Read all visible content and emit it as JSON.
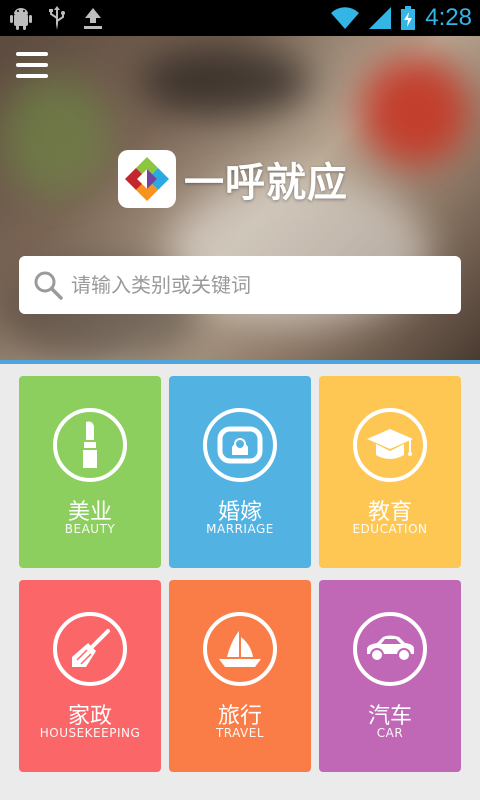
{
  "status_bar": {
    "time": "4:28",
    "left_icons": [
      "android-debug-icon",
      "usb-icon",
      "download-icon"
    ],
    "right_icons": [
      "wifi-icon",
      "signal-icon",
      "battery-charging-icon"
    ]
  },
  "header": {
    "app_name": "一呼就应",
    "menu_icon": "hamburger-menu-icon"
  },
  "search": {
    "placeholder": "请输入类别或关键词"
  },
  "categories": [
    {
      "name": "美业",
      "name_en": "BEAUTY",
      "icon": "lipstick-icon",
      "color": "#8ccf5f"
    },
    {
      "name": "婚嫁",
      "name_en": "MARRIAGE",
      "icon": "ring-box-icon",
      "color": "#52b3e3"
    },
    {
      "name": "教育",
      "name_en": "EDUCATION",
      "icon": "graduation-cap-icon",
      "color": "#fec653"
    },
    {
      "name": "家政",
      "name_en": "HOUSEKEEPING",
      "icon": "broom-icon",
      "color": "#fb6669"
    },
    {
      "name": "旅行",
      "name_en": "TRAVEL",
      "icon": "sailboat-icon",
      "color": "#fa7d48"
    },
    {
      "name": "汽车",
      "name_en": "CAR",
      "icon": "car-icon",
      "color": "#c067b6"
    }
  ],
  "colors": {
    "accent": "#33b5e5",
    "divider": "#4fa6dd",
    "background": "#ebebeb"
  }
}
